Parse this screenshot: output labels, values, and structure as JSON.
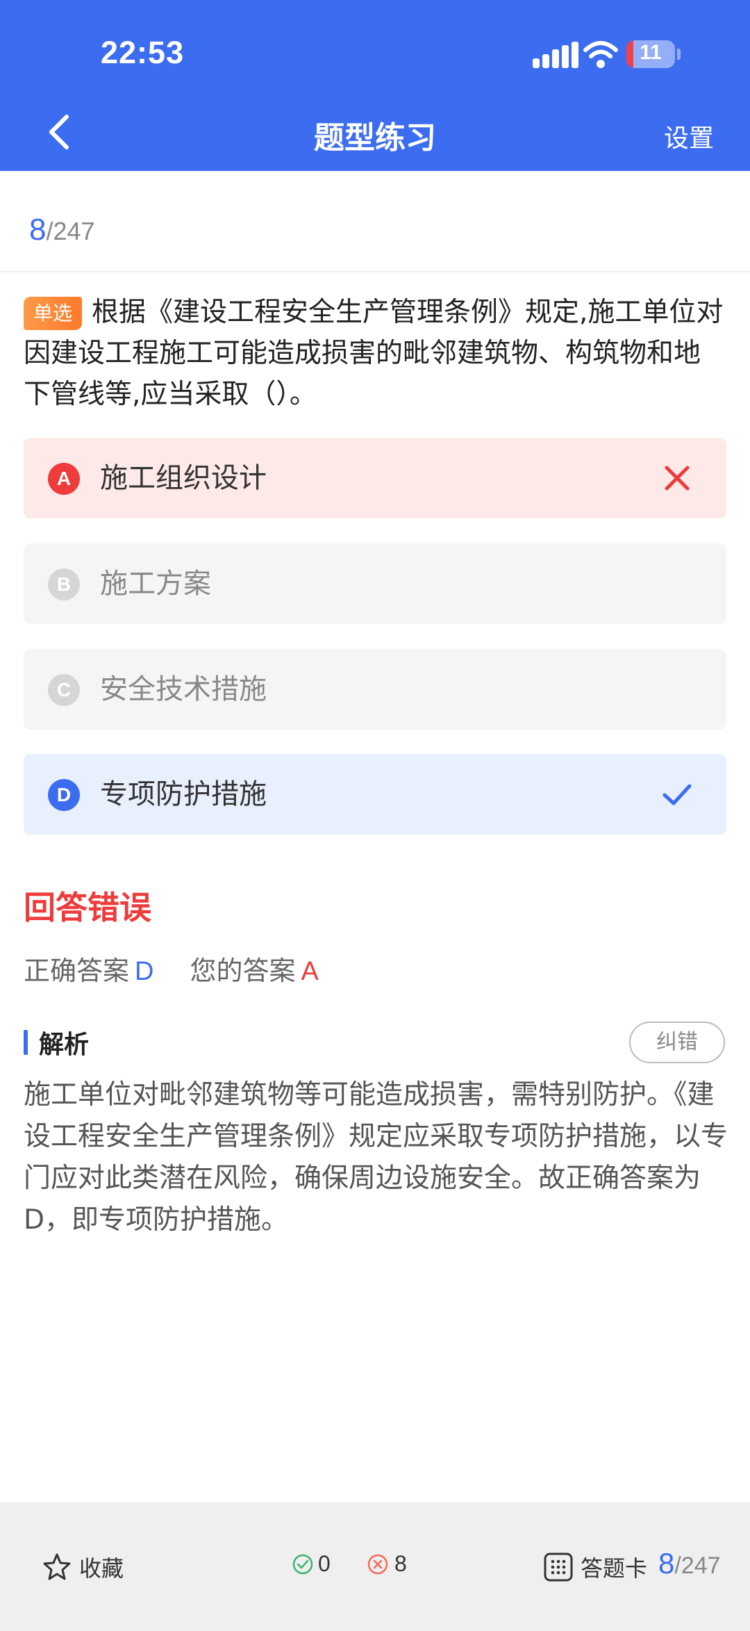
{
  "status_bar": {
    "time": "22:53",
    "battery": "11"
  },
  "header": {
    "title": "题型练习",
    "settings_label": "设置"
  },
  "progress": {
    "current": "8",
    "total": "/247"
  },
  "question": {
    "type_tag": "单选",
    "text": "根据《建设工程安全生产管理条例》规定,施工单位对因建设工程施工可能造成损害的毗邻建筑物、构筑物和地下管线等,应当采取（）。"
  },
  "options": [
    {
      "letter": "A",
      "text": "施工组织设计",
      "state": "wrong"
    },
    {
      "letter": "B",
      "text": "施工方案",
      "state": "normal"
    },
    {
      "letter": "C",
      "text": "安全技术措施",
      "state": "normal"
    },
    {
      "letter": "D",
      "text": "专项防护措施",
      "state": "correct"
    }
  ],
  "result": {
    "status": "回答错误",
    "correct_label": "正确答案",
    "correct_letter": "D",
    "yours_label": "您的答案",
    "yours_letter": "A"
  },
  "analysis": {
    "title": "解析",
    "report_button": "纠错",
    "text": "施工单位对毗邻建筑物等可能造成损害，需特别防护。《建设工程安全生产管理条例》规定应采取专项防护措施，以专门应对此类潜在风险，确保周边设施安全。故正确答案为D，即专项防护措施。"
  },
  "bottom_bar": {
    "favorite_label": "收藏",
    "correct_count": "0",
    "wrong_count": "8",
    "answer_card_label": "答题卡",
    "progress_current": "8",
    "progress_total": "/247"
  },
  "colors": {
    "primary": "#3c6cf0",
    "error": "#ee3b3b",
    "wrong_bg": "#fde9e8",
    "correct_bg": "#e8effd",
    "neutral_bg": "#f5f5f5"
  }
}
